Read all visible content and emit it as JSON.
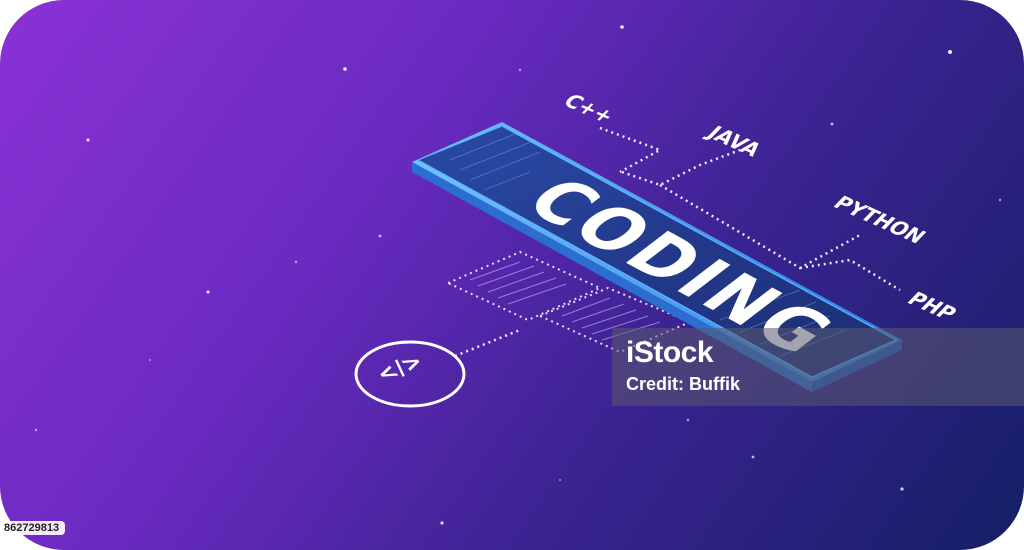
{
  "scene": {
    "headline": "CODING",
    "languages": [
      "C++",
      "JAVA",
      "PYTHON",
      "PHP"
    ],
    "code_symbol": "</>"
  },
  "watermark": {
    "brand": "iStock",
    "credit": "Credit: Buffik",
    "photo_id": "862729813"
  },
  "colors": {
    "background_start": "#8a32d6",
    "background_end": "#141f66",
    "phone_screen": "#233a8c",
    "accent_edge": "#4aa8ff"
  }
}
